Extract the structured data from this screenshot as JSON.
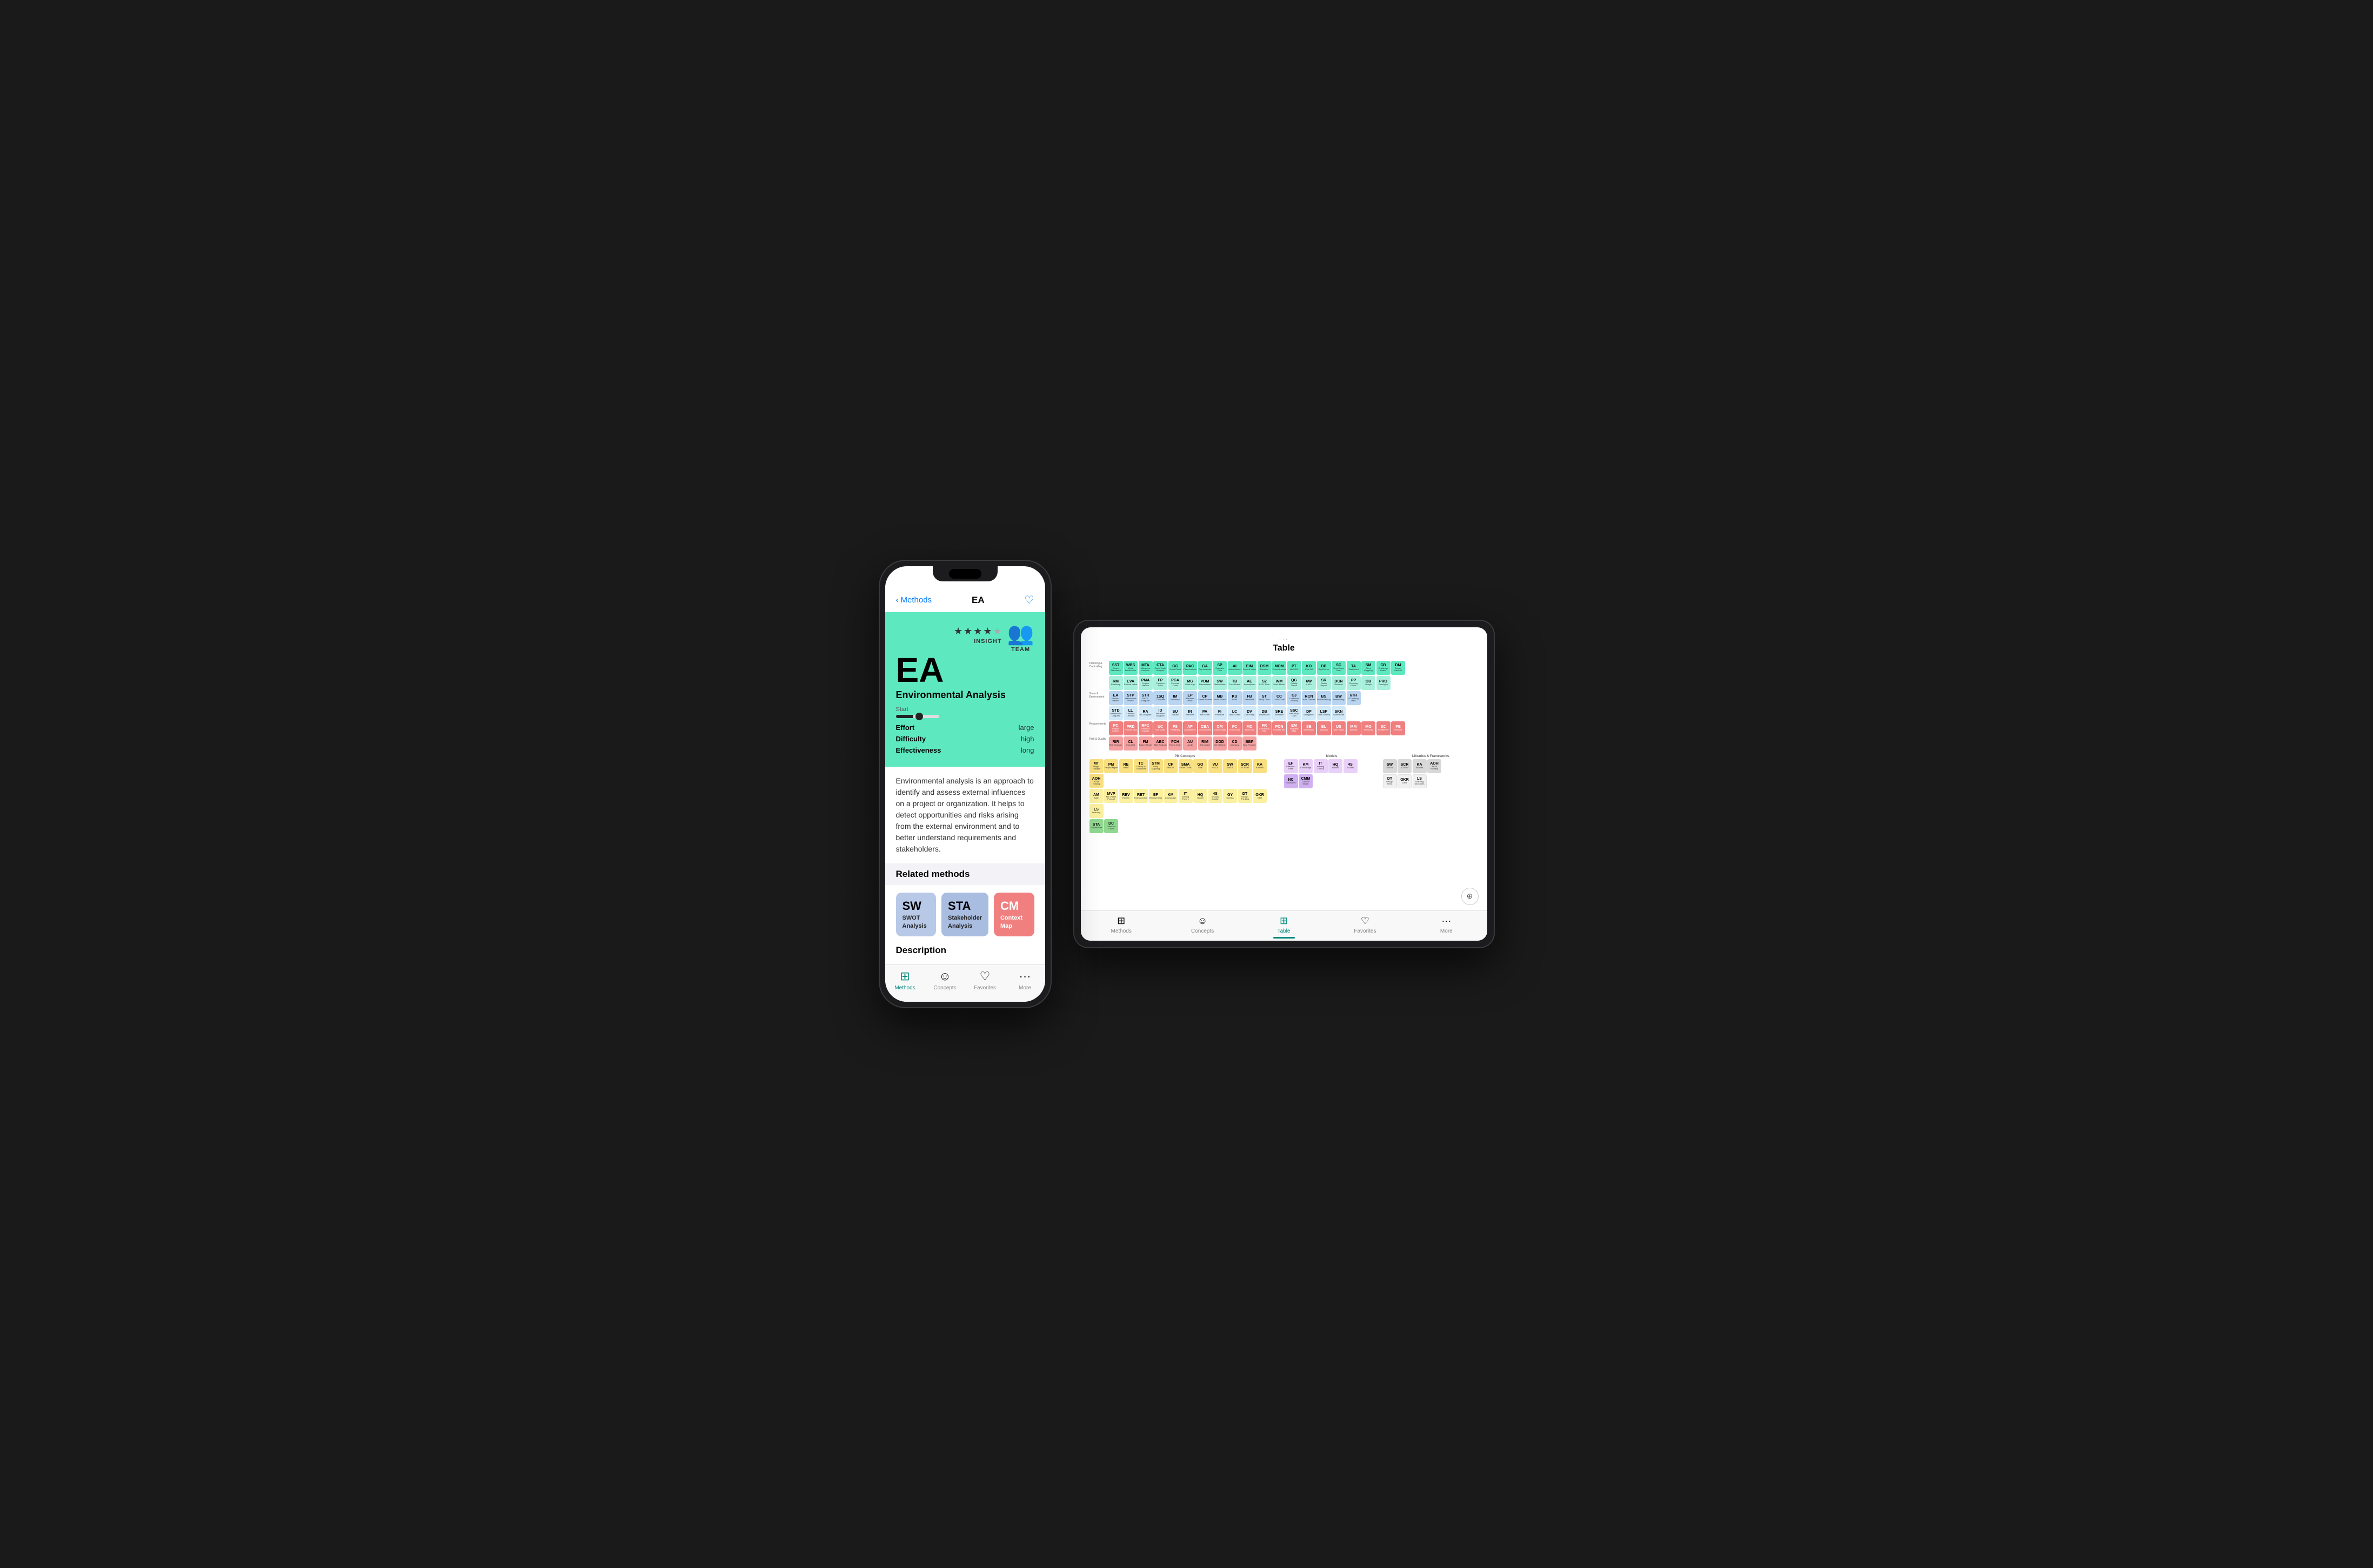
{
  "phone": {
    "nav": {
      "back_label": "Methods",
      "title": "EA",
      "heart_icon": "♡"
    },
    "hero": {
      "stars": 4,
      "total_stars": 5,
      "insight_label": "INSIGHT",
      "acronym": "EA",
      "full_name": "Environmental Analysis",
      "team_icon": "👥",
      "team_label": "TEAM",
      "effort_label": "Effort",
      "effort_value": "large",
      "difficulty_label": "Difficulty",
      "difficulty_value": "high",
      "effectiveness_label": "Effectiveness",
      "effectiveness_value": "long"
    },
    "description": "Environmental analysis is an approach to identify and assess external influences on a project or organization. It helps to detect opportunities and risks arising from the external environment and to better understand requirements and stakeholders.",
    "related_methods_header": "Related methods",
    "related_cards": [
      {
        "acronym": "SW",
        "name": "SWOT Analysis",
        "color": "blue"
      },
      {
        "acronym": "STA",
        "name": "Stakeholder Analysis",
        "color": "blue2"
      },
      {
        "acronym": "CM",
        "name": "Context Map",
        "color": "pink"
      }
    ],
    "description_header": "Description",
    "tabbar": [
      {
        "label": "Methods",
        "icon": "⊞",
        "active": true
      },
      {
        "label": "Concepts",
        "icon": "☺"
      },
      {
        "label": "Favorites",
        "icon": "♡"
      },
      {
        "label": "More",
        "icon": "···"
      }
    ]
  },
  "tablet": {
    "dots": "···",
    "title": "Table",
    "zoom_icon": "⊕",
    "tabbar": [
      {
        "label": "Methods",
        "icon": "⊞"
      },
      {
        "label": "Concepts",
        "icon": "☺"
      },
      {
        "label": "Table",
        "icon": "⊞",
        "active": true
      },
      {
        "label": "Favorites",
        "icon": "♡"
      },
      {
        "label": "More",
        "icon": "···"
      }
    ],
    "rows": [
      {
        "label": "Planning & Controlling",
        "cells": [
          {
            "a": "SST",
            "n": "Scope Statement",
            "c": "c-teal"
          },
          {
            "a": "WBS",
            "n": "Work Breakdown",
            "c": "c-teal"
          },
          {
            "a": "MTA",
            "n": "Milestone Analysis",
            "c": "c-teal"
          },
          {
            "a": "CTA",
            "n": "Cash-Trade Analysis",
            "c": "c-teal"
          },
          {
            "a": "GC",
            "n": "Gantt Chart",
            "c": "c-teal"
          },
          {
            "a": "PAC",
            "n": "Planned Analysis",
            "c": "c-teal"
          },
          {
            "a": "GA",
            "n": "Gap Analysis",
            "c": "c-teal"
          },
          {
            "a": "SP",
            "n": "Scenario Planning",
            "c": "c-teal"
          },
          {
            "a": "AI",
            "n": "Action Items",
            "c": "c-teal"
          },
          {
            "a": "EIM",
            "n": "Earned Value Mgmt",
            "c": "c-teal"
          },
          {
            "a": "DSM",
            "n": "Design Struct Matrix",
            "c": "c-teal"
          },
          {
            "a": "MOM",
            "n": "Minutes",
            "c": "c-teal"
          },
          {
            "a": "PT",
            "n": "Pert Technique",
            "c": "c-teal"
          },
          {
            "a": "KO",
            "n": "Kick Off",
            "c": "c-teal"
          },
          {
            "a": "BP",
            "n": "Big Picture",
            "c": "c-teal"
          },
          {
            "a": "SC",
            "n": "Sem-Down Chart",
            "c": "c-teal"
          },
          {
            "a": "TA",
            "n": "Taskboard",
            "c": "c-teal"
          },
          {
            "a": "SM",
            "n": "Story Mapping",
            "c": "c-teal"
          },
          {
            "a": "CB",
            "n": "Challenge Board",
            "c": "c-teal"
          },
          {
            "a": "DM",
            "n": "Disney Method",
            "c": "c-teal"
          }
        ]
      },
      {
        "label": "",
        "cells": [
          {
            "a": "RM",
            "n": "Roadmap",
            "c": "c-light-teal"
          },
          {
            "a": "EVA",
            "n": "Earned Value Analysis",
            "c": "c-light-teal"
          },
          {
            "a": "PMA",
            "n": "Project Manual",
            "c": "c-light-teal"
          },
          {
            "a": "FP",
            "n": "Function Point",
            "c": "c-light-teal"
          },
          {
            "a": "PCA",
            "n": "Process Chart Analysis",
            "c": "c-light-teal"
          },
          {
            "a": "MG",
            "n": "Mind Map",
            "c": "c-light-teal"
          },
          {
            "a": "PDM",
            "n": "Precedence Diagram",
            "c": "c-light-teal"
          },
          {
            "a": "SW",
            "n": "Stakeholder Whorl",
            "c": "c-light-teal"
          },
          {
            "a": "TB",
            "n": "Task Board",
            "c": "c-light-teal"
          },
          {
            "a": "AE",
            "n": "Assumption Enumeration",
            "c": "c-light-teal"
          },
          {
            "a": "S2",
            "n": "S2S/Role",
            "c": "c-light-teal"
          },
          {
            "a": "WM",
            "n": "Work Model",
            "c": "c-light-teal"
          },
          {
            "a": "QG",
            "n": "Quality Gates",
            "c": "c-light-teal"
          },
          {
            "a": "6W",
            "n": "6W",
            "c": "c-light-teal"
          },
          {
            "a": "SR",
            "n": "Status Report",
            "c": "c-light-teal"
          },
          {
            "a": "DCN",
            "n": "Decision",
            "c": "c-light-teal"
          },
          {
            "a": "PP",
            "n": "Planning Poker",
            "c": "c-light-teal"
          },
          {
            "a": "OB",
            "n": "Obeya",
            "c": "c-light-teal"
          },
          {
            "a": "PRO",
            "n": "Prototype",
            "c": "c-light-teal"
          }
        ]
      },
      {
        "label": "Team & Environment",
        "cells": [
          {
            "a": "EA",
            "n": "Environ-mental Analysis",
            "c": "c-blue"
          },
          {
            "a": "STP",
            "n": "Stakeholder Profile",
            "c": "c-blue"
          },
          {
            "a": "STR",
            "n": "RACI-Diagram",
            "c": "c-blue"
          },
          {
            "a": "1SQ",
            "n": "1-Square",
            "c": "c-blue"
          },
          {
            "a": "IM",
            "n": "Inventory of Means",
            "c": "c-blue"
          },
          {
            "a": "EP",
            "n": "Elevator Pitch",
            "c": "c-blue"
          },
          {
            "a": "CP",
            "n": "Communication Plan",
            "c": "c-blue"
          },
          {
            "a": "MB",
            "n": "Mood Board",
            "c": "c-blue"
          },
          {
            "a": "KU",
            "n": "Kudo",
            "c": "c-blue"
          },
          {
            "a": "FB",
            "n": "Feedback",
            "c": "c-blue"
          },
          {
            "a": "ST",
            "n": "Story Clinic",
            "c": "c-blue"
          },
          {
            "a": "CC",
            "n": "Color Coding",
            "c": "c-blue"
          },
          {
            "a": "CJ",
            "n": "Customer Journey",
            "c": "c-blue"
          },
          {
            "a": "RCN",
            "n": "Role Model Canvas",
            "c": "c-blue"
          },
          {
            "a": "BS",
            "n": "Brain-storming",
            "c": "c-blue"
          },
          {
            "a": "BW",
            "n": "Brainwrinting",
            "c": "c-blue"
          },
          {
            "a": "6TH",
            "n": "6 Thinking Hats",
            "c": "c-blue"
          }
        ]
      },
      {
        "label": "",
        "cells": [
          {
            "a": "STD",
            "n": "Stakeholder Diagram",
            "c": "c-light-blue"
          },
          {
            "a": "LL",
            "n": "Lessons Learned",
            "c": "c-light-blue"
          },
          {
            "a": "RA",
            "n": "RA-Diagram",
            "c": "c-light-blue"
          },
          {
            "a": "ID",
            "n": "Influence Diagram",
            "c": "c-light-blue"
          },
          {
            "a": "SU",
            "n": "Survey",
            "c": "c-light-blue"
          },
          {
            "a": "IN",
            "n": "Interview",
            "c": "c-light-blue"
          },
          {
            "a": "PA",
            "n": "Pre-Chart",
            "c": "c-light-blue"
          },
          {
            "a": "FI",
            "n": "Fishbone",
            "c": "c-light-blue"
          },
          {
            "a": "LC",
            "n": "Lean Coffee",
            "c": "c-light-blue"
          },
          {
            "a": "DV",
            "n": "Dot Voting",
            "c": "c-light-blue"
          },
          {
            "a": "DB",
            "n": "Dashboard",
            "c": "c-light-blue"
          },
          {
            "a": "SRE",
            "n": "Tabular Selection",
            "c": "c-light-blue"
          },
          {
            "a": "SSC",
            "n": "Start-Stop-Continue",
            "c": "c-light-blue"
          },
          {
            "a": "DP",
            "n": "Delegation Poker",
            "c": "c-light-blue"
          },
          {
            "a": "LSP",
            "n": "Lean Startup Plan",
            "c": "c-light-blue"
          },
          {
            "a": "SKN",
            "n": "Sketch-note",
            "c": "c-light-blue"
          }
        ]
      },
      {
        "label": "Requirements",
        "cells": [
          {
            "a": "PC",
            "n": "Project Charter",
            "c": "c-pink"
          },
          {
            "a": "PRD",
            "n": "Product Requirements",
            "c": "c-pink"
          },
          {
            "a": "RFC",
            "n": "Request for Change",
            "c": "c-pink"
          },
          {
            "a": "UC",
            "n": "Use Case",
            "c": "c-pink"
          },
          {
            "a": "FS",
            "n": "Feasibility Study",
            "c": "c-pink"
          },
          {
            "a": "AP",
            "n": "Acceptance Protocol",
            "c": "c-pink"
          },
          {
            "a": "CBA",
            "n": "Cost-Benefit Analysis",
            "c": "c-pink"
          },
          {
            "a": "CM",
            "n": "Context Map",
            "c": "c-pink"
          },
          {
            "a": "FC",
            "n": "Flow Chart",
            "c": "c-pink"
          },
          {
            "a": "MC",
            "n": "MoSCoW",
            "c": "c-pink"
          },
          {
            "a": "FR",
            "n": "Functional Requirements",
            "c": "c-pink"
          },
          {
            "a": "PCN",
            "n": "Process Net",
            "c": "c-pink"
          },
          {
            "a": "EM",
            "n": "Empathy Map",
            "c": "c-pink"
          },
          {
            "a": "SB",
            "n": "Story Board",
            "c": "c-pink"
          },
          {
            "a": "BL",
            "n": "Backlog",
            "c": "c-pink"
          },
          {
            "a": "US",
            "n": "User Story",
            "c": "c-pink"
          },
          {
            "a": "MM",
            "n": "Mockup",
            "c": "c-pink"
          },
          {
            "a": "MO",
            "n": "MoSCoW Analysis",
            "c": "c-pink"
          },
          {
            "a": "SC",
            "n": "SCAMPER",
            "c": "c-pink"
          },
          {
            "a": "PE",
            "n": "Persona",
            "c": "c-pink"
          }
        ]
      },
      {
        "label": "Risk & Quality",
        "cells": [
          {
            "a": "RIR",
            "n": "Risk Register",
            "c": "c-salmon"
          },
          {
            "a": "CL",
            "n": "Checklist",
            "c": "c-salmon"
          },
          {
            "a": "FM",
            "n": "Failure Mode",
            "c": "c-salmon"
          },
          {
            "a": "ABC",
            "n": "ABC Analysis",
            "c": "c-salmon"
          },
          {
            "a": "PCH",
            "n": "Pareto Chart",
            "c": "c-salmon"
          },
          {
            "a": "AU",
            "n": "Audit",
            "c": "c-salmon"
          },
          {
            "a": "RIM",
            "n": "Risk Matrix",
            "c": "c-salmon"
          },
          {
            "a": "DOD",
            "n": "Definition of Done",
            "c": "c-salmon"
          },
          {
            "a": "CD",
            "n": "Category",
            "c": "c-salmon"
          },
          {
            "a": "BBP",
            "n": "Best-Bad Practice",
            "c": "c-salmon"
          }
        ]
      }
    ],
    "bottom_sections": [
      {
        "label": "PM Concepts",
        "cells": [
          {
            "a": "MT",
            "n": "Magic Triangle",
            "c": "c-yellow"
          },
          {
            "a": "PM",
            "n": "Project Mgmt",
            "c": "c-yellow"
          },
          {
            "a": "RE",
            "n": "Retro",
            "c": "c-yellow"
          },
          {
            "a": "TC",
            "n": "Theory of Constraints",
            "c": "c-yellow"
          },
          {
            "a": "STM",
            "n": "Story Mapping",
            "c": "c-yellow"
          },
          {
            "a": "CF",
            "n": "SMART",
            "c": "c-yellow"
          },
          {
            "a": "SMA",
            "n": "Smart Goals",
            "c": "c-yellow"
          },
          {
            "a": "GO",
            "n": "Goal",
            "c": "c-yellow"
          },
          {
            "a": "VU",
            "n": "VUCA",
            "c": "c-yellow"
          },
          {
            "a": "SW",
            "n": "SWOT",
            "c": "c-yellow"
          },
          {
            "a": "SCR",
            "n": "SCRUM",
            "c": "c-yellow"
          },
          {
            "a": "KA",
            "n": "Kanban",
            "c": "c-yellow"
          },
          {
            "a": "AOH",
            "n": "Art of Hosting",
            "c": "c-yellow"
          }
        ]
      },
      {
        "label": "",
        "cells": [
          {
            "a": "AM",
            "n": "Agile Manifesto",
            "c": "c-light-yellow"
          },
          {
            "a": "MVP",
            "n": "Min Viable Product",
            "c": "c-light-yellow"
          },
          {
            "a": "REV",
            "n": "Review",
            "c": "c-light-yellow"
          },
          {
            "a": "RET",
            "n": "Retrospective",
            "c": "c-light-yellow"
          },
          {
            "a": "EF",
            "n": "Effectiveness",
            "c": "c-light-yellow"
          },
          {
            "a": "KM",
            "n": "Knowledge Mgmt",
            "c": "c-light-yellow"
          },
          {
            "a": "IT",
            "n": "Iceberg Theory",
            "c": "c-light-yellow"
          },
          {
            "a": "HQ",
            "n": "Hansei",
            "c": "c-light-yellow"
          },
          {
            "a": "4S",
            "n": "4 Sides of Quality",
            "c": "c-light-yellow"
          },
          {
            "a": "GY",
            "n": "Gemba",
            "c": "c-light-yellow"
          },
          {
            "a": "DT",
            "n": "Design Thinking",
            "c": "c-light-yellow"
          },
          {
            "a": "OKR",
            "n": "OKR",
            "c": "c-light-yellow"
          },
          {
            "a": "LS",
            "n": "Learning Structures",
            "c": "c-light-yellow"
          }
        ]
      },
      {
        "label": "",
        "cells": [
          {
            "a": "STA",
            "n": "Stakeholder Analysis",
            "c": "c-green"
          },
          {
            "a": "DC",
            "n": "Diamond Circles",
            "c": "c-green"
          },
          {
            "a": "NC",
            "n": "Normative Context",
            "c": "c-green"
          },
          {
            "a": "CMM",
            "n": "Context Mgmt Model",
            "c": "c-green"
          }
        ]
      }
    ]
  }
}
